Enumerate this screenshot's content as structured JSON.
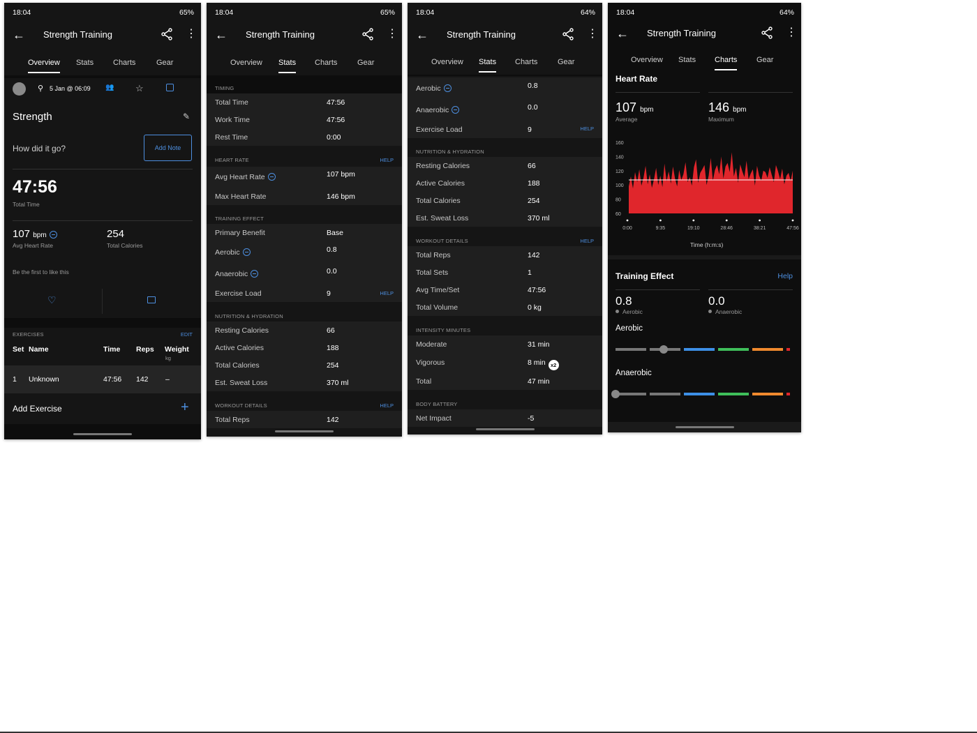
{
  "common": {
    "title": "Strength Training",
    "tabs": [
      "Overview",
      "Stats",
      "Charts",
      "Gear"
    ],
    "time": "18:04"
  },
  "s1": {
    "battery": "65%",
    "date": "5 Jan @ 06:09",
    "activity_name": "Strength",
    "prompt": "How did it go?",
    "add_note": "Add Note",
    "total_time": "47:56",
    "total_time_label": "Total Time",
    "avg_hr": "107",
    "avg_hr_unit": "bpm",
    "avg_hr_label": "Avg Heart Rate",
    "total_cal": "254",
    "total_cal_label": "Total Calories",
    "like_text": "Be the first to like this",
    "exercises_label": "EXERCISES",
    "edit": "EDIT",
    "cols": {
      "set": "Set",
      "name": "Name",
      "time": "Time",
      "reps": "Reps",
      "weight": "Weight",
      "weight_unit": "kg"
    },
    "exercise_row": {
      "set": "1",
      "name": "Unknown",
      "time": "47:56",
      "reps": "142",
      "weight": "–"
    },
    "add_exercise": "Add Exercise"
  },
  "s2": {
    "battery": "65%",
    "timing": "TIMING",
    "total_time_l": "Total Time",
    "total_time_v": "47:56",
    "work_time_l": "Work Time",
    "work_time_v": "47:56",
    "rest_time_l": "Rest Time",
    "rest_time_v": "0:00",
    "heart_rate": "HEART RATE",
    "help": "HELP",
    "avg_hr_l": "Avg Heart Rate",
    "avg_hr_v": "107 bpm",
    "max_hr_l": "Max Heart Rate",
    "max_hr_v": "146 bpm",
    "training_effect": "TRAINING EFFECT",
    "primary_l": "Primary Benefit",
    "primary_v": "Base",
    "aerobic_l": "Aerobic",
    "aerobic_v": "0.8",
    "anaerobic_l": "Anaerobic",
    "anaerobic_v": "0.0",
    "load_l": "Exercise Load",
    "load_v": "9",
    "nutrition": "NUTRITION & HYDRATION",
    "resting_l": "Resting Calories",
    "resting_v": "66",
    "active_l": "Active Calories",
    "active_v": "188",
    "totalcal_l": "Total Calories",
    "totalcal_v": "254",
    "sweat_l": "Est. Sweat Loss",
    "sweat_v": "370 ml",
    "workout": "WORKOUT DETAILS",
    "reps_l": "Total Reps",
    "reps_v": "142"
  },
  "s3": {
    "battery": "64%",
    "aerobic_l": "Aerobic",
    "aerobic_v": "0.8",
    "anaerobic_l": "Anaerobic",
    "anaerobic_v": "0.0",
    "load_l": "Exercise Load",
    "load_v": "9",
    "help": "HELP",
    "nutrition": "NUTRITION & HYDRATION",
    "resting_l": "Resting Calories",
    "resting_v": "66",
    "active_l": "Active Calories",
    "active_v": "188",
    "totalcal_l": "Total Calories",
    "totalcal_v": "254",
    "sweat_l": "Est. Sweat Loss",
    "sweat_v": "370 ml",
    "workout": "WORKOUT DETAILS",
    "reps_l": "Total Reps",
    "reps_v": "142",
    "sets_l": "Total Sets",
    "sets_v": "1",
    "avgset_l": "Avg Time/Set",
    "avgset_v": "47:56",
    "volume_l": "Total Volume",
    "volume_v": "0 kg",
    "intensity": "INTENSITY MINUTES",
    "moderate_l": "Moderate",
    "moderate_v": "31 min",
    "vigorous_l": "Vigorous",
    "vigorous_v": "8 min",
    "x2": "x2",
    "total_l": "Total",
    "total_v": "47 min",
    "body_battery": "BODY BATTERY",
    "impact_l": "Net Impact",
    "impact_v": "-5"
  },
  "s4": {
    "battery": "64%",
    "heart_rate": "Heart Rate",
    "avg": "107",
    "avg_unit": "bpm",
    "avg_label": "Average",
    "max": "146",
    "max_unit": "bpm",
    "max_label": "Maximum",
    "y_ticks": [
      "160",
      "140",
      "120",
      "100",
      "80",
      "60"
    ],
    "x_ticks": [
      "0:00",
      "9:35",
      "19:10",
      "28:46",
      "38:21",
      "47:56"
    ],
    "x_label": "Time (h:m:s)",
    "te_title": "Training Effect",
    "te_help": "Help",
    "te_aerobic": "0.8",
    "te_aerobic_label": "Aerobic",
    "te_anaerobic": "0.0",
    "te_anaerobic_label": "Anaerobic",
    "aerobic_bar_label": "Aerobic",
    "anaerobic_bar_label": "Anaerobic",
    "aerobic_level": 0.8,
    "anaerobic_level": 0.0
  },
  "chart_data": {
    "type": "area",
    "xlabel": "Time (h:m:s)",
    "ylim": [
      60,
      160
    ],
    "x_ticks": [
      "0:00",
      "9:35",
      "19:10",
      "28:46",
      "38:21",
      "47:56"
    ],
    "avg_line": 107,
    "values": [
      98,
      112,
      95,
      118,
      104,
      122,
      99,
      110,
      127,
      101,
      115,
      96,
      108,
      124,
      100,
      113,
      97,
      130,
      105,
      119,
      102,
      126,
      109,
      98,
      121,
      107,
      115,
      132,
      104,
      111,
      99,
      125,
      136,
      103,
      117,
      122,
      128,
      100,
      113,
      138,
      106,
      121,
      128,
      115,
      140,
      109,
      126,
      131,
      118,
      146,
      112,
      124,
      103,
      129,
      119,
      111,
      134,
      108,
      116,
      122,
      99,
      127,
      113,
      106,
      120,
      118,
      110,
      125,
      114,
      104,
      128,
      119,
      108,
      123,
      101,
      113,
      117,
      106,
      120
    ]
  },
  "colors": {
    "accent": "#4d8fe0",
    "hr_fill": "#e0262c"
  }
}
